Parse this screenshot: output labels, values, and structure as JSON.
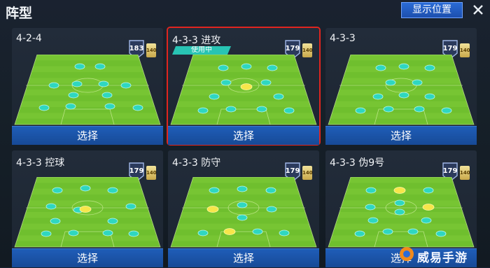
{
  "header": {
    "title": "阵型",
    "show_position_label": "显示位置"
  },
  "colors": {
    "accent": "#e0251f",
    "button_blue": "#1f5db8",
    "pitch_green": "#6fbf2e",
    "player_teal": "#2fd7c0",
    "in_use_tag": "#28c4b4"
  },
  "formations": [
    {
      "name": "4-2-4",
      "rating": "183",
      "chem": "140",
      "in_use": false,
      "tag": "",
      "select_label": "选择",
      "highlighted": []
    },
    {
      "name": "4-3-3 进攻",
      "rating": "179",
      "chem": "140",
      "in_use": true,
      "tag": "使用中",
      "select_label": "选择",
      "highlighted": [
        5
      ]
    },
    {
      "name": "4-3-3",
      "rating": "179",
      "chem": "140",
      "in_use": false,
      "tag": "",
      "select_label": "选择",
      "highlighted": []
    },
    {
      "name": "4-3-3 控球",
      "rating": "179",
      "chem": "140",
      "in_use": false,
      "tag": "",
      "select_label": "选择",
      "highlighted": [
        6
      ]
    },
    {
      "name": "4-3-3 防守",
      "rating": "179",
      "chem": "140",
      "in_use": false,
      "tag": "",
      "select_label": "选择",
      "highlighted": [
        4,
        8
      ]
    },
    {
      "name": "4-3-3 伪9号",
      "rating": "179",
      "chem": "140",
      "in_use": false,
      "tag": "",
      "select_label": "选择",
      "highlighted": [
        1,
        5
      ]
    }
  ],
  "watermark": {
    "text": "威易手游"
  }
}
